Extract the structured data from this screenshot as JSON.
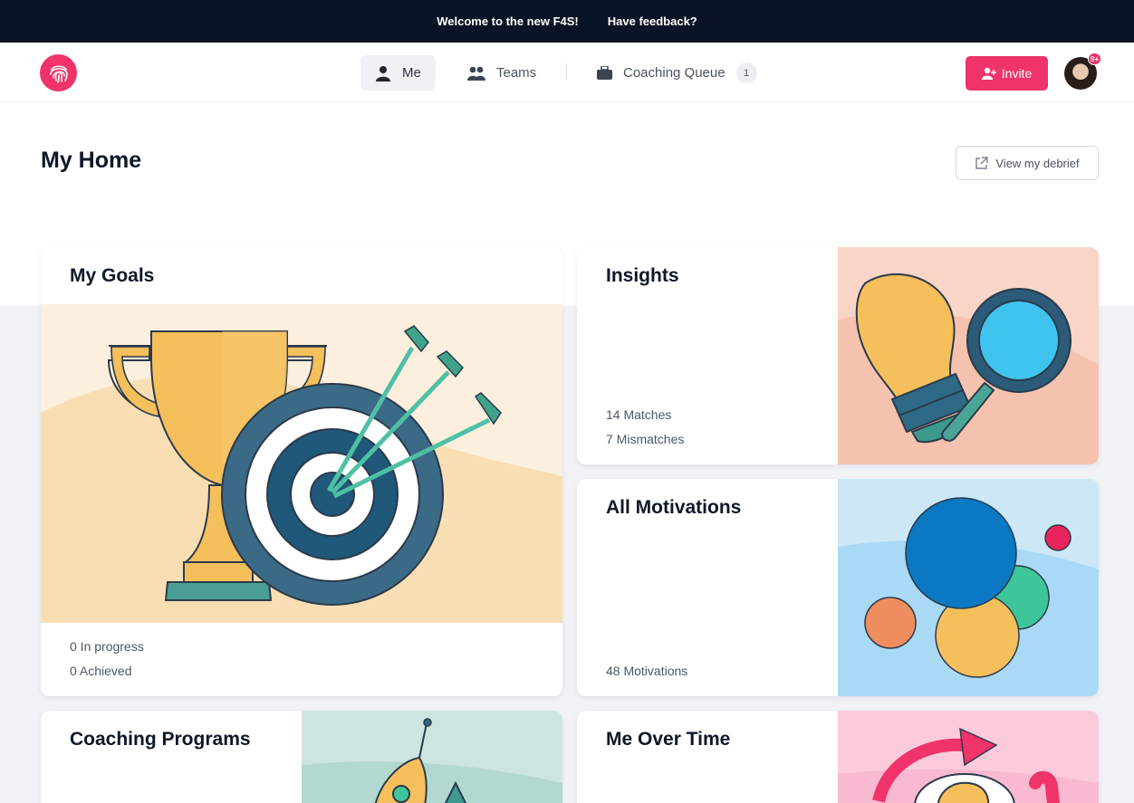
{
  "banner": {
    "welcome": "Welcome to the new F4S!",
    "feedback": "Have feedback?"
  },
  "nav": {
    "logo": "fingerprint-logo",
    "tabs": [
      {
        "label": "Me",
        "icon": "person-icon",
        "active": true
      },
      {
        "label": "Teams",
        "icon": "people-icon",
        "active": false
      },
      {
        "label": "Coaching Queue",
        "icon": "briefcase-icon",
        "badge": "1",
        "active": false
      }
    ],
    "invite_label": "Invite",
    "avatar_badge": "9+"
  },
  "page": {
    "title": "My Home",
    "debrief_label": "View my debrief"
  },
  "cards": {
    "goals": {
      "title": "My Goals",
      "stats": [
        "0 In progress",
        "0 Achieved"
      ],
      "illustration": "trophy-target-illustration"
    },
    "insights": {
      "title": "Insights",
      "stats": [
        "14 Matches",
        "7 Mismatches"
      ],
      "illustration": "lightbulb-magnifier-illustration"
    },
    "motivations": {
      "title": "All Motivations",
      "stats": [
        "48 Motivations"
      ],
      "illustration": "bubbles-illustration"
    },
    "coaching": {
      "title": "Coaching Programs",
      "illustration": "rocket-illustration"
    },
    "over_time": {
      "title": "Me Over Time",
      "illustration": "cycle-arrow-illustration"
    }
  },
  "colors": {
    "brand": "#f0336a",
    "banner_bg": "#0b1424",
    "page_bg": "#f1f2f6"
  }
}
